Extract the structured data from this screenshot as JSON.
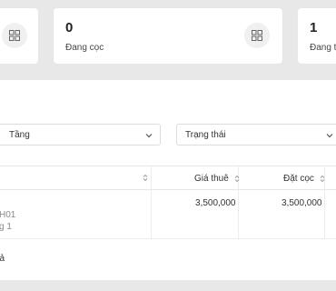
{
  "stats": [
    {
      "value": "",
      "label": ""
    },
    {
      "value": "0",
      "label": "Đang cọc"
    },
    {
      "value": "1",
      "label": "Đang thuê"
    }
  ],
  "filters": {
    "floor": "Tầng",
    "status": "Trạng thái"
  },
  "table": {
    "columns": [
      "",
      "Giá thuê",
      "Đặt cọc"
    ],
    "rows": [
      {
        "room": "H01",
        "floor": "g 1",
        "rent": "3,500,000",
        "deposit": "3,500,000"
      }
    ]
  },
  "footer": "uả",
  "icons": {
    "card": "grid-icon",
    "select": "chevron-down-icon",
    "sort": "sort-icon"
  }
}
